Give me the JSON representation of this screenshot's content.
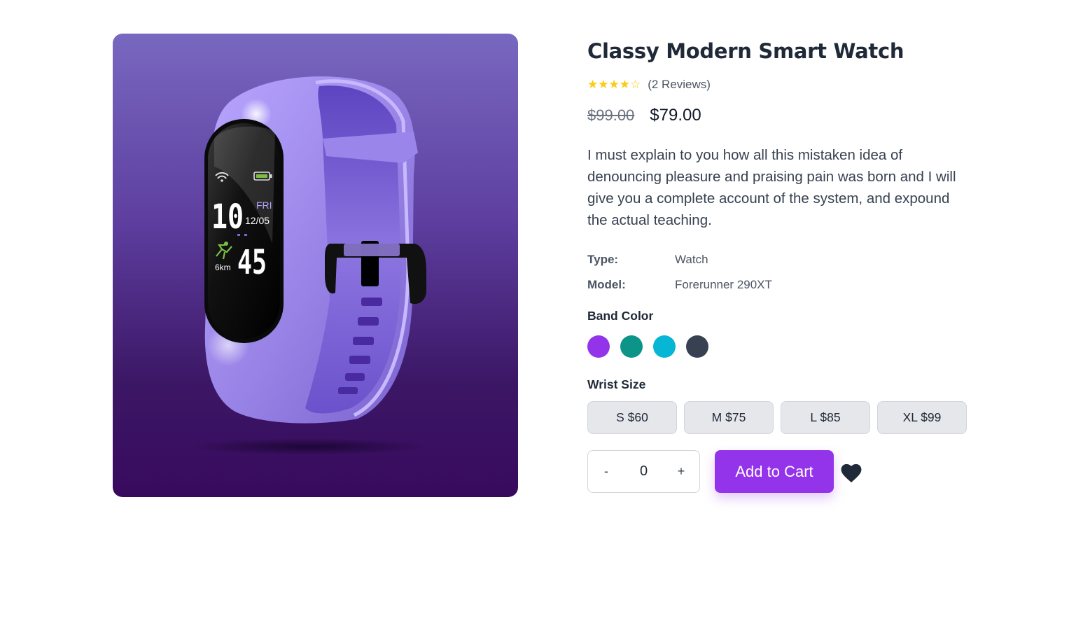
{
  "product": {
    "title": "Classy Modern Smart Watch",
    "rating": 4.5,
    "rating_stars": "★★★★☆",
    "reviews_text": "(2 Reviews)",
    "old_price": "$99.00",
    "price": "$79.00",
    "description": "I must explain to you how all this mistaken idea of denouncing pleasure and praising pain was born and I will give you a complete account of the system, and expound the actual teaching.",
    "image_alt": "smart-watch-product-image"
  },
  "watch_screen": {
    "hour": "10",
    "day": "FRI",
    "date": "12/05",
    "minute": "45",
    "distance": "6km"
  },
  "specs": [
    {
      "label": "Type:",
      "value": "Watch"
    },
    {
      "label": "Model:",
      "value": "Forerunner 290XT"
    }
  ],
  "band_color": {
    "label": "Band Color",
    "options": [
      {
        "name": "purple",
        "color": "#9333ea"
      },
      {
        "name": "teal",
        "color": "#0d9488"
      },
      {
        "name": "cyan",
        "color": "#06b6d4"
      },
      {
        "name": "slate",
        "color": "#374151"
      }
    ]
  },
  "wrist_size": {
    "label": "Wrist Size",
    "options": [
      "S $60",
      "M $75",
      "L $85",
      "XL $99"
    ]
  },
  "quantity": {
    "decrement": "-",
    "value": "0",
    "increment": "+"
  },
  "actions": {
    "add_to_cart": "Add to Cart",
    "wishlist_icon": "heart-icon"
  },
  "colors": {
    "accent": "#9333ea",
    "star": "#facc15",
    "heart": "#1f2937"
  }
}
